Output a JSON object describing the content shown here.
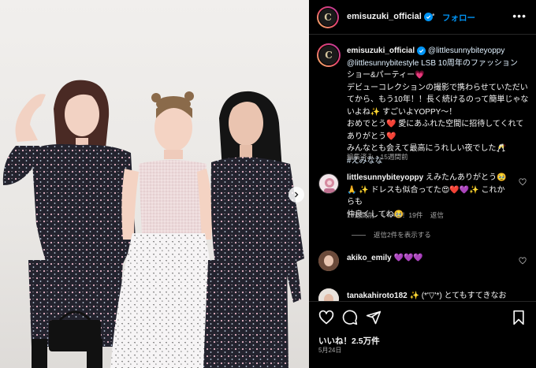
{
  "post": {
    "username": "emisuzuki_official",
    "follow_label": "フォロー",
    "separator": "•",
    "more_label": "•••",
    "avatar_letter": "C"
  },
  "caption": {
    "username": "emisuzuki_official",
    "lines": [
      "@littlesunnybiteyoppy",
      "@littlesunnybitestyle LSB 10周年のファッション",
      "ショー&パーティー💗",
      "デビューコレクションの撮影で携わらせていただい",
      "てから、もう10年！！長く続けるのって簡単じゃな",
      "いよね✨ すごいよYOPPY〜！",
      "おめでとう❤️ 愛にあふれた空間に招待してくれて",
      "ありがとう❤️",
      "みんなとも会えて最高にうれしい夜でした🥂",
      "#えみなな"
    ],
    "edited_meta": "編集済み・15週間前"
  },
  "comments": [
    {
      "username": "littlesunnybiteyoppy",
      "text_lines": [
        "えみたんありがとう🥹",
        "🙏 ✨ ドレスも似合ってた😍❤️💜✨ これからも",
        "仲良くしてね🥹"
      ],
      "time": "15週間前",
      "likes": "いいね！19件",
      "reply": "返信",
      "view_replies": "返信2件を表示する"
    },
    {
      "username": "akiko_emily",
      "text_lines": [
        "💜💜💜"
      ]
    },
    {
      "username": "tanakahiroto182",
      "text_lines": [
        "✨ (*'▽'*) とてもすてきなお写"
      ]
    }
  ],
  "footer": {
    "likes": "いいね！2.5万件",
    "date": "5月24日"
  },
  "colors": {
    "accent": "#0095f6",
    "background": "#000000",
    "secondary_text": "#a8a8a8"
  },
  "icons": [
    "heart-icon",
    "comment-icon",
    "share-icon",
    "bookmark-icon",
    "verified-badge-icon",
    "chevron-right-icon"
  ]
}
